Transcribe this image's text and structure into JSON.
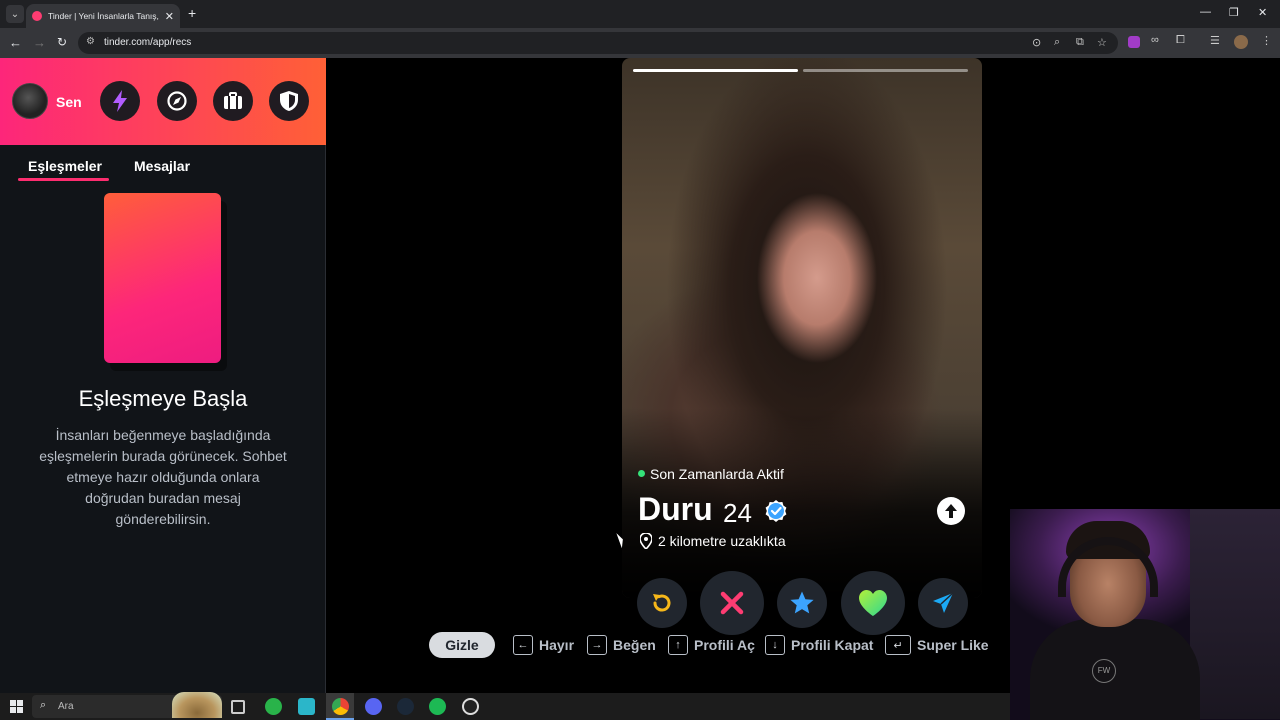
{
  "browser": {
    "tab_title": "Tinder | Yeni İnsanlarla Tanış, Bu",
    "url": "tinder.com/app/recs"
  },
  "sidebar": {
    "user_label": "Sen",
    "tabs": [
      {
        "label": "Eşleşmeler",
        "active": true
      },
      {
        "label": "Mesajlar",
        "active": false
      }
    ],
    "empty_state": {
      "title": "Eşleşmeye Başla",
      "description": "İnsanları beğenmeye başladığında eşleşmelerin burada görünecek. Sohbet etmeye hazır olduğunda onlara doğrudan buradan mesaj gönderebilirsin."
    },
    "header_icons": [
      "boost-icon",
      "explore-icon",
      "work-icon",
      "safety-shield-icon"
    ]
  },
  "profile": {
    "status": "Son Zamanlarda Aktif",
    "name": "Duru",
    "age": "24",
    "verified": true,
    "distance": "2 kilometre uzaklıkta",
    "photo_count": 2,
    "current_photo": 1
  },
  "actions": [
    {
      "name": "rewind",
      "color": "#f6b71a"
    },
    {
      "name": "nope",
      "color": "#fe3c72"
    },
    {
      "name": "super-like",
      "color": "#3ca4ff"
    },
    {
      "name": "like",
      "color": "#36e38e"
    },
    {
      "name": "boost",
      "color": "#1ca9f5"
    }
  ],
  "shortcuts": {
    "hide_label": "Gizle",
    "items": [
      {
        "key": "←",
        "label": "Hayır"
      },
      {
        "key": "→",
        "label": "Beğen"
      },
      {
        "key": "↑",
        "label": "Profili Aç"
      },
      {
        "key": "↓",
        "label": "Profili Kapat"
      },
      {
        "key": "↵",
        "label": "Super Like"
      }
    ]
  },
  "taskbar": {
    "search_placeholder": "Ara"
  },
  "colors": {
    "brand_start": "#fd267a",
    "brand_end": "#ff6036",
    "active_dot": "#35e27a",
    "verified": "#3ca4ff"
  }
}
